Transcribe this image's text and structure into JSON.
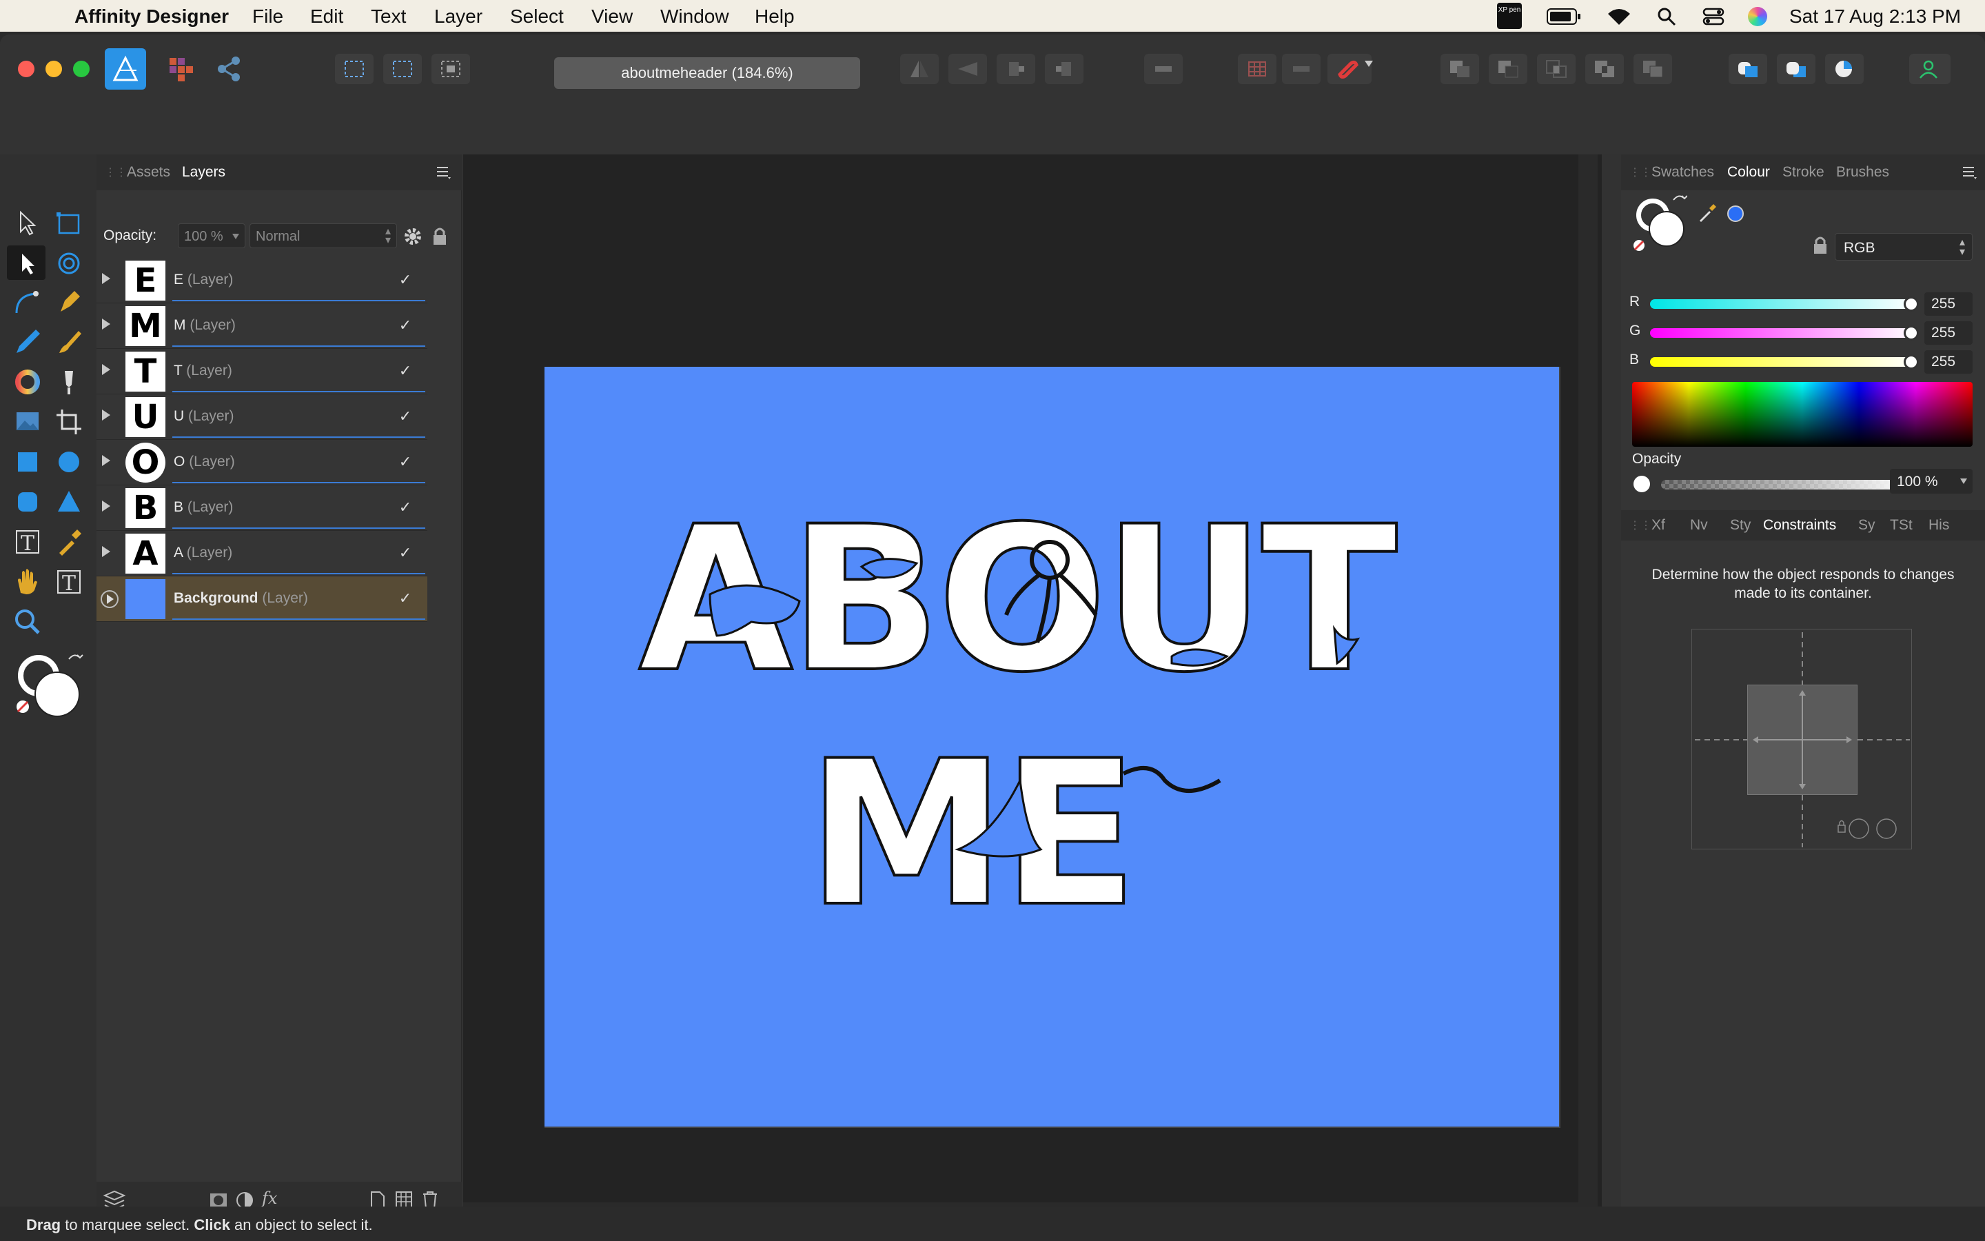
{
  "menubar": {
    "app_name": "Affinity Designer",
    "items": [
      "File",
      "Edit",
      "Text",
      "Layer",
      "Select",
      "View",
      "Window",
      "Help"
    ],
    "tray_badge": "XP pen",
    "datetime": "Sat 17 Aug  2:13 PM"
  },
  "toolbar": {
    "document_title": "aboutmeheader (184.6%)"
  },
  "layers_panel": {
    "tabs": [
      "Assets",
      "Layers"
    ],
    "active_tab": "Layers",
    "opacity_label": "Opacity:",
    "opacity_value": "100 %",
    "blend_mode": "Normal",
    "layers": [
      {
        "thumb": "E",
        "name": "E",
        "type": "(Layer)"
      },
      {
        "thumb": "M",
        "name": "M",
        "type": "(Layer)"
      },
      {
        "thumb": "T",
        "name": "T",
        "type": "(Layer)"
      },
      {
        "thumb": "U",
        "name": "U",
        "type": "(Layer)"
      },
      {
        "thumb": "O",
        "name": "O",
        "type": "(Layer)"
      },
      {
        "thumb": "B",
        "name": "B",
        "type": "(Layer)"
      },
      {
        "thumb": "A",
        "name": "A",
        "type": "(Layer)"
      },
      {
        "thumb": "",
        "name": "Background",
        "type": "(Layer)"
      }
    ],
    "selected_layer": "Background"
  },
  "canvas": {
    "line1": "ABOUT",
    "line2": "ME",
    "background_color": "#538bfa"
  },
  "colour_panel": {
    "tabs": [
      "Swatches",
      "Colour",
      "Stroke",
      "Brushes"
    ],
    "active_tab": "Colour",
    "mode": "RGB",
    "r_label": "R",
    "r": "255",
    "g_label": "G",
    "g": "255",
    "b_label": "B",
    "b": "255",
    "opacity_label": "Opacity",
    "opacity": "100 %"
  },
  "lower_panel": {
    "tabs": [
      "Xf",
      "Nv",
      "Sty",
      "Constraints",
      "Sy",
      "TSt",
      "His"
    ],
    "active_tab": "Constraints",
    "description": "Determine how the object responds to changes made to its container."
  },
  "status": {
    "drag_word": "Drag",
    "drag_text": " to marquee select. ",
    "click_word": "Click",
    "click_text": " an object to select it."
  },
  "colors": {
    "accent_blue": "#3a7bd5",
    "artboard_blue": "#538bfa",
    "snapping_red": "#e03b3b",
    "persona_blue": "#2a93e6"
  }
}
